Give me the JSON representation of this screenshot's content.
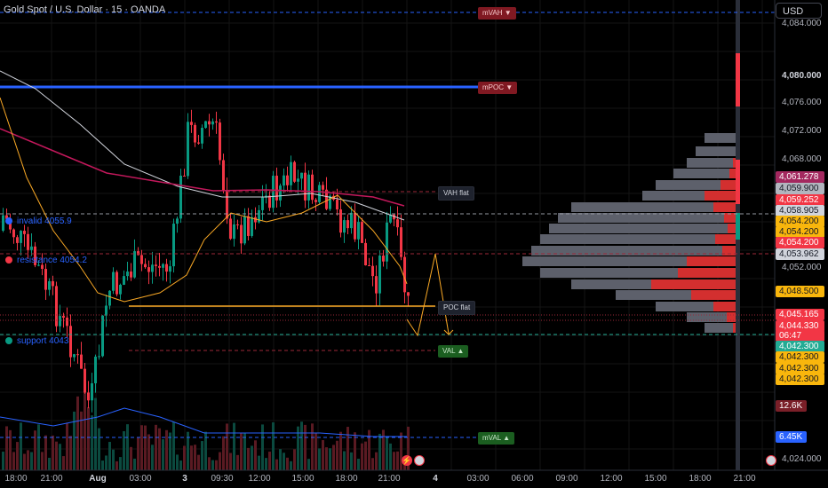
{
  "header": {
    "title": "Gold Spot / U.S. Dollar · 15 · OANDA",
    "currency_button": "USD"
  },
  "legend": [
    {
      "id": "invalid",
      "label": "invalid 4055.9",
      "dot_color": "#2962ff"
    },
    {
      "id": "resistance",
      "label": "resistance 4054.2",
      "dot_color": "#f23645"
    },
    {
      "id": "support",
      "label": "support 4043",
      "dot_color": "#089981"
    }
  ],
  "tags": {
    "mvah": "mVAH ▼",
    "mpoc": "mPOC ▼",
    "vah_flat": "VAH flat",
    "poc_flat": "POC flat",
    "val": "VAL ▲",
    "mval": "mVAL ▲"
  },
  "price_axis": [
    "4,084.000",
    "4,080.000",
    "4,076.000",
    "4,072.000",
    "4,068.000",
    "4,052.000",
    "4,024.000"
  ],
  "price_labels": [
    {
      "text": "4,061.278",
      "bg": "#a4285f",
      "fg": "#ffffff"
    },
    {
      "text": "4,059.900",
      "bg": "#b2b5be",
      "fg": "#131722"
    },
    {
      "text": "4,059.252",
      "bg": "#f23645",
      "fg": "#ffffff"
    },
    {
      "text": "4,058.905",
      "bg": "#d1d4dc",
      "fg": "#131722"
    },
    {
      "text": "4,054.200",
      "bg": "#f9b60c",
      "fg": "#131722"
    },
    {
      "text": "4,054.200",
      "bg": "#f9b60c",
      "fg": "#131722"
    },
    {
      "text": "4,054.200",
      "bg": "#f23645",
      "fg": "#ffffff"
    },
    {
      "text": "4,053.962",
      "bg": "#d1d4dc",
      "fg": "#131722"
    },
    {
      "text": "4,048.500",
      "bg": "#f9b60c",
      "fg": "#131722"
    },
    {
      "text": "4,045.165",
      "bg": "#f23645",
      "fg": "#ffffff"
    },
    {
      "text": "4,044.330",
      "bg": "#f23645",
      "fg": "#ffffff"
    },
    {
      "text": "06:47",
      "bg": "#f23645",
      "fg": "#ffffff"
    },
    {
      "text": "4,042.300",
      "bg": "#22ab94",
      "fg": "#ffffff"
    },
    {
      "text": "4,042.300",
      "bg": "#f9b60c",
      "fg": "#131722"
    },
    {
      "text": "4,042.300",
      "bg": "#f9b60c",
      "fg": "#131722"
    },
    {
      "text": "4,042.300",
      "bg": "#f9b60c",
      "fg": "#131722"
    },
    {
      "text": "12.6K",
      "bg": "#7a1f28",
      "fg": "#ffffff"
    },
    {
      "text": "6.45K",
      "bg": "#2962ff",
      "fg": "#ffffff"
    }
  ],
  "time_axis": [
    {
      "label": "18:00",
      "bold": false
    },
    {
      "label": "21:00",
      "bold": false
    },
    {
      "label": "Aug",
      "bold": true
    },
    {
      "label": "03:00",
      "bold": false
    },
    {
      "label": "3",
      "bold": true
    },
    {
      "label": "09:30",
      "bold": false
    },
    {
      "label": "12:00",
      "bold": false
    },
    {
      "label": "15:00",
      "bold": false
    },
    {
      "label": "18:00",
      "bold": false
    },
    {
      "label": "21:00",
      "bold": false
    },
    {
      "label": "4",
      "bold": true
    },
    {
      "label": "03:00",
      "bold": false
    },
    {
      "label": "06:00",
      "bold": false
    },
    {
      "label": "09:00",
      "bold": false
    },
    {
      "label": "12:00",
      "bold": false
    },
    {
      "label": "15:00",
      "bold": false
    },
    {
      "label": "18:00",
      "bold": false
    },
    {
      "label": "21:00",
      "bold": false
    }
  ],
  "colors": {
    "up": "#089981",
    "down": "#f23645",
    "blue_line": "#2962ff",
    "orange_line": "#f9a825",
    "pink_line": "#c2185b",
    "background": "#000000"
  }
}
